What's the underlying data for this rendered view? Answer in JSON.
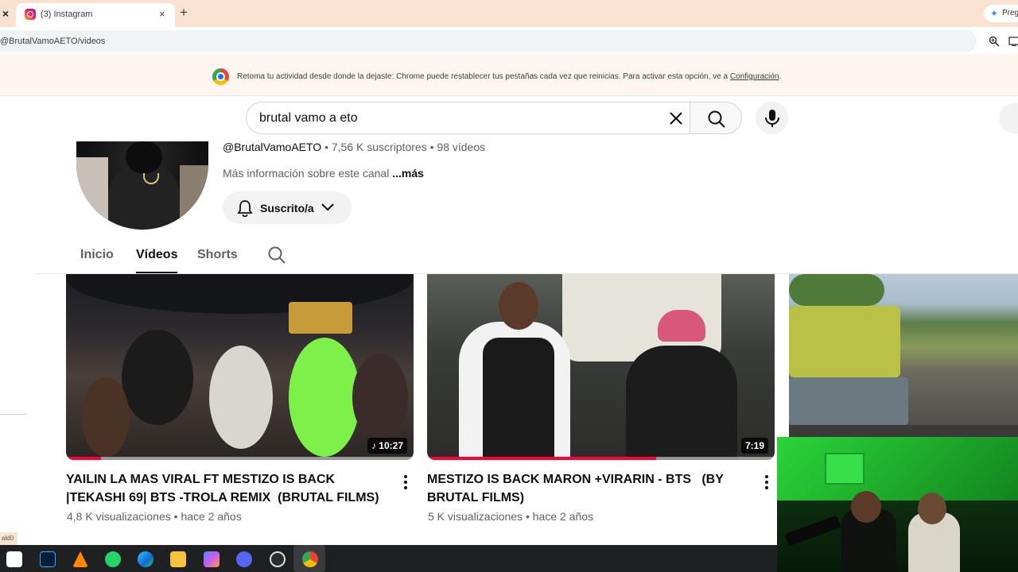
{
  "browser": {
    "tab_title": "(3) Instagram",
    "tab_close": "×",
    "new_tab": "+",
    "left_close": "×",
    "gemini_label": "Preg",
    "url": "@BrutalVamoAETO/videos"
  },
  "infobar": {
    "message": "Retoma tu actividad desde donde la dejaste: Chrome puede restablecer tus pestañas cada vez que reinicias. Para activar esta opción, ve a ",
    "link": "Configuración",
    "suffix": "."
  },
  "search": {
    "query": "brutal vamo a eto"
  },
  "channel": {
    "handle": "@BrutalVamoAETO",
    "subscribers": "7,56 K suscriptores",
    "videos_count": "98 vídeos",
    "separator": " • ",
    "about": "Más información sobre este canal ",
    "more": "...más",
    "subscribe_label": "Suscrito/a"
  },
  "tabs": {
    "inicio": "Inicio",
    "videos": "Vídeos",
    "shorts": "Shorts"
  },
  "videos": [
    {
      "title": "YAILIN LA MAS VIRAL FT MESTIZO IS BACK |TEKASHI 69| BTS -TROLA REMIX  (BRUTAL FILMS)",
      "duration": "10:27",
      "views": "4,8 K visualizaciones",
      "age": "hace 2 años",
      "watched_fraction": 0.1
    },
    {
      "title": "MESTIZO IS BACK MARON +VIRARIN - BTS   (BY BRUTAL FILMS)",
      "duration": "7:19",
      "views": "5 K visualizaciones",
      "age": "hace 2 años",
      "watched_fraction": 0.66
    }
  ],
  "bottom_label": "ald0",
  "colors": {
    "accent_red": "#ff0033",
    "tab_strip": "#f9e2d2",
    "webcam_green": "#2bd43a"
  },
  "taskbar_icons": [
    "capcut-icon",
    "photoshop-icon",
    "vlc-icon",
    "whatsapp-icon",
    "edge-icon",
    "file-explorer-icon",
    "copilot-icon",
    "discord-icon",
    "obs-icon",
    "chrome-icon"
  ]
}
